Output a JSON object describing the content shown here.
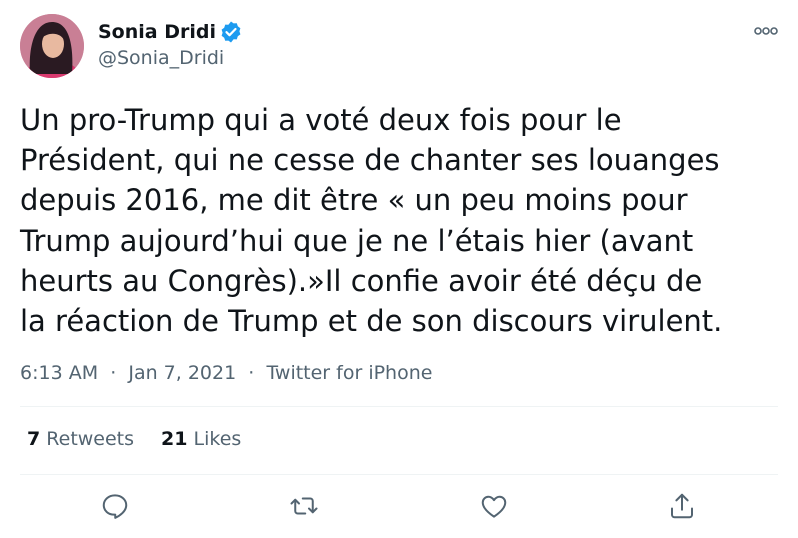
{
  "tweet": {
    "author_name": "Sonia Dridi",
    "author_handle": "@Sonia_Dridi",
    "verified": true,
    "text": "Un pro-Trump qui a voté deux fois pour le\nPrésident, qui ne cesse de chanter ses louanges\ndepuis 2016, me dit être « un peu moins pour\nTrump aujourd’hui que je ne l’étais hier (avant\nheurts au Congrès).»Il confie avoir été déçu de\nla réaction de Trump et de son discours virulent.",
    "time": "6:13 AM",
    "separator": "·",
    "date": "Jan 7, 2021",
    "source": "Twitter for iPhone",
    "retweets_count": "7",
    "retweets_label": "Retweets",
    "likes_count": "21",
    "likes_label": "Likes"
  },
  "icons": {
    "more": "more-options-icon",
    "reply": "reply-icon",
    "retweet": "retweet-icon",
    "like": "like-icon",
    "share": "share-icon",
    "verified": "verified-badge-icon"
  },
  "colors": {
    "accent": "#1d9bf0",
    "secondary_text": "#536471",
    "primary_text": "#0f1419",
    "divider": "#eff3f4"
  }
}
